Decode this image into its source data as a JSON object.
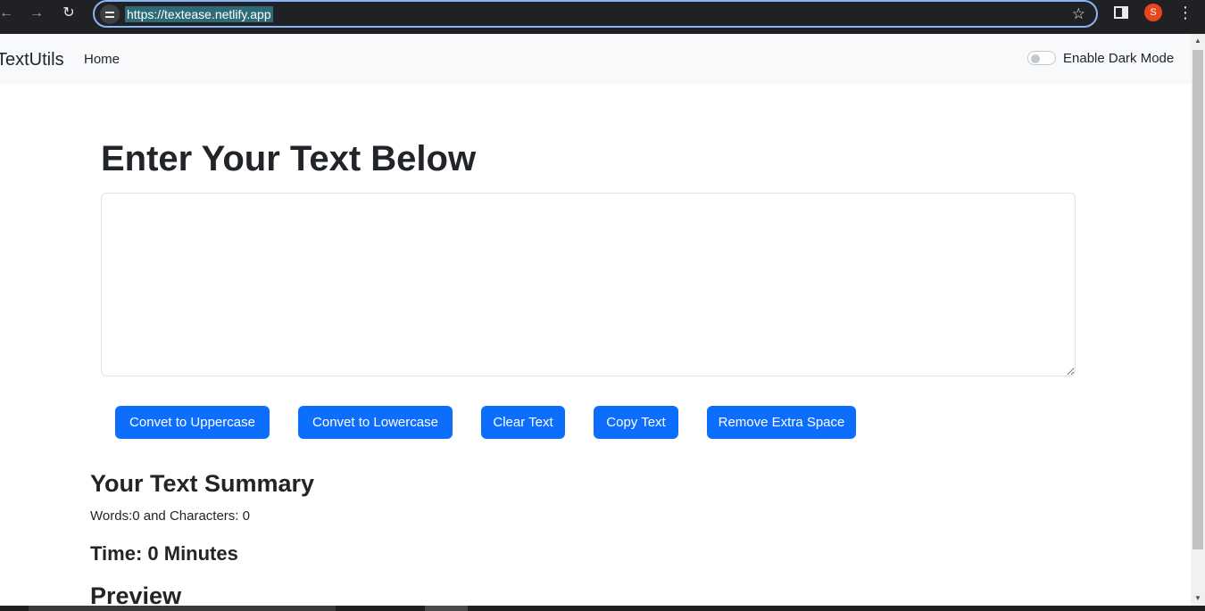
{
  "browser": {
    "url": "https://textease.netlify.app",
    "profile_initial": "S",
    "icons": {
      "back": "arrow-left-icon",
      "forward": "arrow-right-icon",
      "reload": "reload-icon",
      "site_info": "site-info-icon",
      "bookmark": "star-icon",
      "side_panel": "side-panel-icon",
      "menu": "kebab-menu-icon"
    }
  },
  "navbar": {
    "brand": "TextUtils",
    "links": [
      "Home"
    ],
    "dark_mode_label": "Enable Dark Mode",
    "dark_mode_enabled": false
  },
  "main": {
    "heading": "Enter Your Text Below",
    "textarea_value": "",
    "buttons": [
      "Convet to Uppercase",
      "Convet to Lowercase",
      "Clear Text",
      "Copy Text",
      "Remove Extra Space"
    ],
    "summary_title": "Your Text Summary",
    "counts_text": "Words:0 and Characters: 0",
    "time_text": "Time: 0 Minutes",
    "preview_title": "Preview"
  },
  "colors": {
    "primary": "#0d6efd",
    "navbar_bg": "#f8f9fa",
    "chrome_bg": "#202124",
    "omnibox_border": "#8ab4f8",
    "profile": "#e8471c"
  }
}
